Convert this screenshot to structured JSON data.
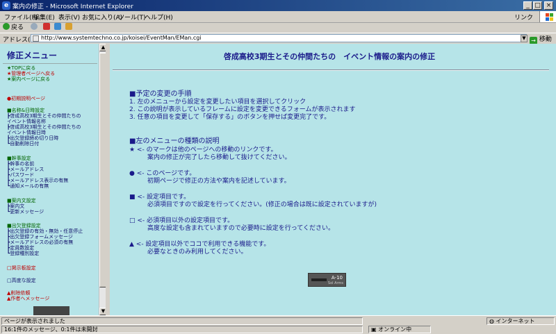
{
  "window": {
    "title": "案内の修正 - Microsoft Internet Explorer",
    "min_glyph": "_",
    "max_glyph": "□",
    "close_glyph": "×"
  },
  "menubar": {
    "items": [
      "ファイル(F)",
      "編集(E)",
      "表示(V)",
      "お気に入り(A)",
      "ツール(T)",
      "ヘルプ(H)"
    ],
    "links_label": "リンク"
  },
  "toolbar": {
    "back_label": "戻る",
    "forward_glyph": "→"
  },
  "address": {
    "label": "アドレス(D)",
    "url": "http://www.systemtechno.co.jp/koisei/EventMan/EMan.cgi",
    "go_label": "移動"
  },
  "left_frame": {
    "title": "修正メニュー",
    "nav_links": [
      "★TOPに戻る",
      "★管理者ページへ戻る",
      "★案内ページに戻る"
    ],
    "intro": "●初期説明ページ",
    "sections": [
      {
        "heading": "■名称&日時設定",
        "items": [
          "┣啓成高校3期生とその仲間たちの",
          "イベント情報名称",
          "┣啓成高校3期生とその仲間たちの",
          "イベント情報日時",
          "┣出欠登録締め切り日時",
          "┗自動削除日付"
        ]
      },
      {
        "heading": "■幹事設定",
        "items": [
          "┣幹事の名前",
          "┣メールアドレス",
          "┣パスワード",
          "┣メールアドレス表示の有無",
          "┗通知メールの有無"
        ]
      },
      {
        "heading": "■案内文設定",
        "items": [
          "┣案内文",
          "┗更新メッセージ"
        ]
      },
      {
        "heading": "■出欠登録設定",
        "items": [
          "┣出欠登録の有効・無効・任意停止",
          "┣出欠登録フォームメッセージ",
          "┣メールアドレスの必須の有無",
          "┣定員数設定",
          "┗登録種別設定"
        ]
      }
    ],
    "bottom_items": [
      "□掲示板設定",
      "□高度な設定"
    ],
    "end_items": [
      "▲削除依頼",
      "▲作者へメッセージ"
    ]
  },
  "main_frame": {
    "title": "啓成高校3期生とその仲間たちの　イベント情報の案内の修正",
    "procedure_heading": "■予定の変更の手順",
    "procedure_steps": [
      "1. 左のメニューから設定を変更したい項目を選択してクリック",
      "2. この説明が表示しているフレームに設定を変更できるフォームが表示されます",
      "3. 任意の項目を変更して「保存する」のボタンを押せば変更完了です。"
    ],
    "types_heading": "■左のメニューの種類の説明",
    "types": [
      {
        "line1": "★ <- のマークは他のページへの移動のリンクです。",
        "line2": "案内の修正が完了したら移動して抜けてください。"
      },
      {
        "line1": "● <- このページです。",
        "line2": "初期ページで修正の方法や案内を記述しています。"
      },
      {
        "line1": "■ <- 設定項目です。",
        "line2": "必須項目ですので設定を行ってください。(修正の場合は既に設定されていますが)"
      },
      {
        "line1": "□ <- 必須項目以外の設定項目です。",
        "line2": "高度な設定も含まれていますので必要時に設定を行ってください。"
      },
      {
        "line1": "▲ <- 設定項目以外でココで利用できる機能です。",
        "line2": "必要なときのみ利用してください。"
      }
    ],
    "logo": {
      "line1": "A-10",
      "line2": "Sol Arms"
    }
  },
  "statusbar": {
    "line1": "ページが表示されました",
    "line2": "16:1件のメッセージ、0:1件は未開封",
    "online_label": "オンライン中",
    "zone_label": "インターネット"
  }
}
